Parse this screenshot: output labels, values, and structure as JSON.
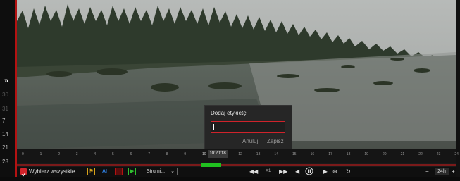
{
  "dialog": {
    "title": "Dodaj etykietę",
    "input_value": "",
    "cancel_label": "Anuluj",
    "save_label": "Zapisz"
  },
  "left_panel": {
    "collapse_glyph": "»",
    "day_labels": [
      "30",
      "31",
      "7",
      "14",
      "21",
      "28"
    ]
  },
  "timeline": {
    "hours": [
      "0",
      "1",
      "2",
      "3",
      "4",
      "5",
      "6",
      "7",
      "8",
      "9",
      "10",
      "11",
      "12",
      "13",
      "14",
      "15",
      "16",
      "17",
      "18",
      "19",
      "20",
      "21",
      "22",
      "23",
      "24"
    ],
    "current_time": "10:20:18"
  },
  "toolbar": {
    "select_all_label": "Wybierz wszystkie",
    "select_all_checked": true,
    "stream_select_value": "Strumi...",
    "zoom_minus": "−",
    "zoom_value": "24h",
    "zoom_plus": "+",
    "speed_label": "X1"
  },
  "icons": {
    "motion": "motion-detection-icon",
    "ai": "ai-icon",
    "alarm": "alarm-icon",
    "video": "video-icon",
    "rewind": "rewind-icon",
    "forward": "fast-forward-icon",
    "prev": "previous-frame-icon",
    "pause": "pause-icon",
    "next": "next-frame-icon",
    "snapshot": "snapshot-icon",
    "refresh": "refresh-icon"
  },
  "colors": {
    "accent_red": "#d2232a",
    "recording_green": "#20c020"
  }
}
